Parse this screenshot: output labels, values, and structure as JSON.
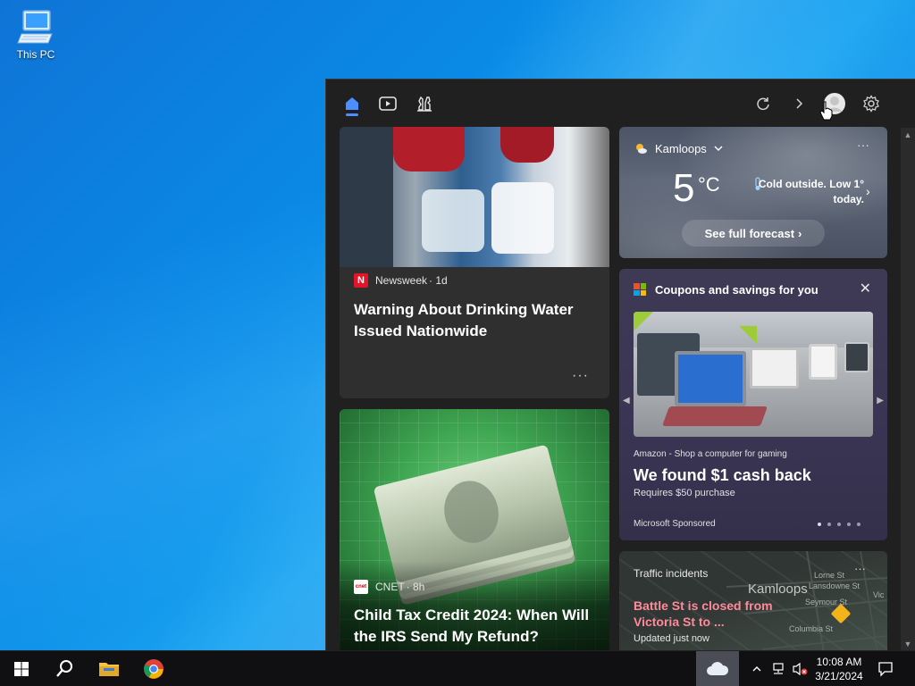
{
  "desktop": {
    "icons": [
      {
        "label": "This PC",
        "icon": "computer-icon"
      }
    ]
  },
  "widgets": {
    "header": {
      "tabs": [
        {
          "icon": "home-icon",
          "active": true
        },
        {
          "icon": "play-video-icon",
          "active": false
        },
        {
          "icon": "chess-icon",
          "active": false
        }
      ],
      "actions": [
        "refresh-icon",
        "chevron-right-icon",
        "avatar",
        "gear-icon"
      ]
    },
    "news": [
      {
        "source": "Newsweek",
        "age": "· 1d",
        "logo_text": "N",
        "logo_color": "#e4132a",
        "headline": "Warning About Drinking Water Issued Nationwide",
        "more": "···"
      },
      {
        "source": "CNET",
        "age": "· 8h",
        "logo_text": "cnet",
        "logo_color": "#ffffff",
        "headline": "Child Tax Credit 2024: When Will the IRS Send My Refund?"
      }
    ],
    "weather": {
      "location": "Kamloops",
      "temp": "5",
      "unit": "°C",
      "note": "Cold outside. Low 1° today.",
      "button": "See full forecast",
      "more": "···"
    },
    "coupons": {
      "title": "Coupons and savings for you",
      "close": "✕",
      "subtitle": "Amazon - Shop a computer for gaming",
      "headline": "We found $1 cash back",
      "requirement": "Requires $50 purchase",
      "sponsor": "Microsoft Sponsored",
      "pages": 5,
      "current_page": 1
    },
    "traffic": {
      "title": "Traffic incidents",
      "alert": "Battle St is closed from Victoria St to ...",
      "updated": "Updated just now",
      "map_city": "Kamloops",
      "map_labels": [
        "Lorne St",
        "Lansdowne St",
        "Seymour St",
        "Columbia St",
        "Vic"
      ],
      "more": "···"
    }
  },
  "taskbar": {
    "time": "10:08 AM",
    "date": "3/21/2024",
    "colors": {
      "background": "#101012",
      "accent": "#4c8dff"
    }
  }
}
